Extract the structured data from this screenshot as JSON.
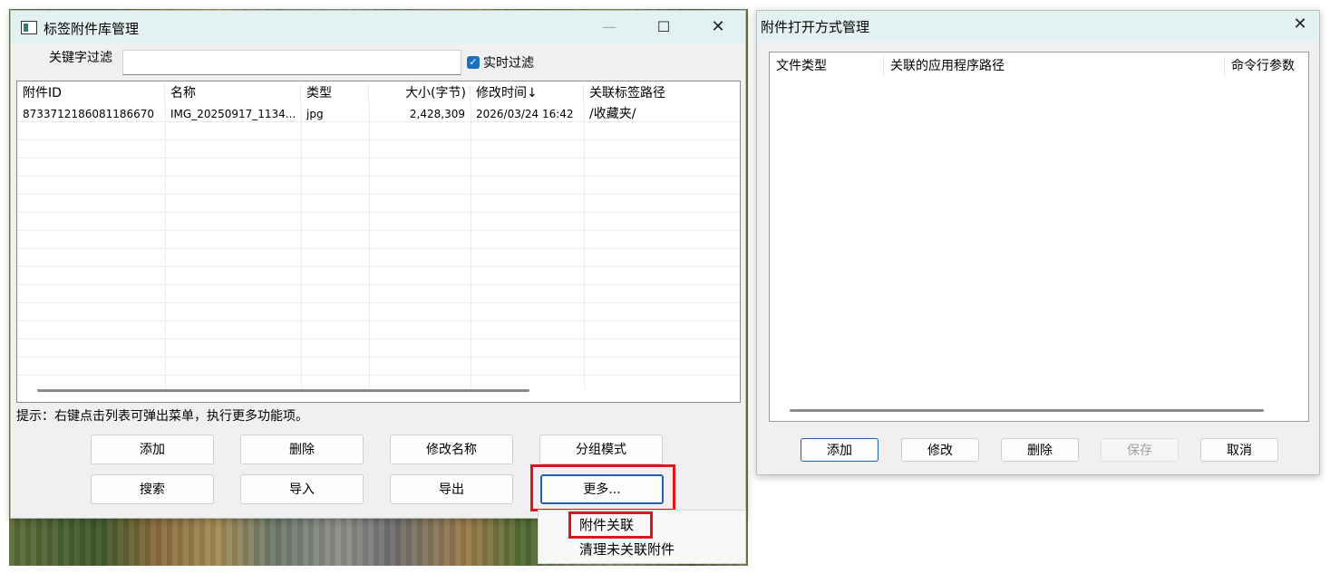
{
  "main_window": {
    "title": "标签附件库管理",
    "filter_label": "关键字过滤",
    "filter_value": "",
    "realtime_label": "实时过滤",
    "columns": [
      "附件ID",
      "名称",
      "类型",
      "大小(字节)",
      "修改时间↓",
      "关联标签路径"
    ],
    "rows": [
      [
        "8733712186081186670",
        "IMG_20250917_1134...",
        "jpg",
        "2,428,309",
        "2026/03/24 16:42",
        "/收藏夹/"
      ]
    ],
    "hint": "提示：右键点击列表可弹出菜单，执行更多功能项。",
    "buttons": {
      "add": "添加",
      "delete": "删除",
      "rename": "修改名称",
      "group": "分组模式",
      "search": "搜索",
      "import": "导入",
      "export": "导出",
      "more": "更多..."
    },
    "context_menu": [
      "附件关联",
      "清理未关联附件"
    ]
  },
  "assoc_window": {
    "title": "附件打开方式管理",
    "columns": [
      "文件类型",
      "关联的应用程序路径",
      "命令行参数"
    ],
    "buttons": {
      "add": "添加",
      "modify": "修改",
      "delete": "删除",
      "save": "保存",
      "cancel": "取消"
    }
  }
}
